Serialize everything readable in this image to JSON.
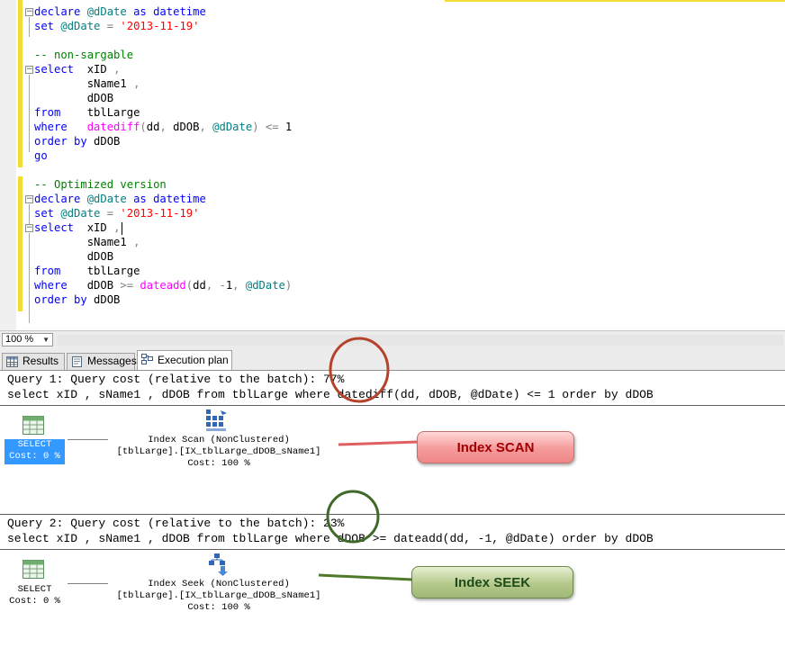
{
  "editor": {
    "lines": [
      [
        {
          "t": "declare ",
          "c": "kw"
        },
        {
          "t": "@dDate ",
          "c": "v"
        },
        {
          "t": "as ",
          "c": "kw"
        },
        {
          "t": "datetime",
          "c": "kw"
        }
      ],
      [
        {
          "t": "set ",
          "c": "kw"
        },
        {
          "t": "@dDate ",
          "c": "v"
        },
        {
          "t": "= ",
          "c": "op"
        },
        {
          "t": "'2013-11-19'",
          "c": "str"
        }
      ],
      [],
      [
        {
          "t": "-- non-sargable",
          "c": "cm"
        }
      ],
      [
        {
          "t": "select  ",
          "c": "kw"
        },
        {
          "t": "xID ",
          "c": ""
        },
        {
          "t": ",",
          "c": "op"
        }
      ],
      [
        {
          "t": "        sName1 ",
          "c": ""
        },
        {
          "t": ",",
          "c": "op"
        }
      ],
      [
        {
          "t": "        dDOB",
          "c": ""
        }
      ],
      [
        {
          "t": "from    ",
          "c": "kw"
        },
        {
          "t": "tblLarge",
          "c": ""
        }
      ],
      [
        {
          "t": "where   ",
          "c": "kw"
        },
        {
          "t": "datediff",
          "c": "fn"
        },
        {
          "t": "(",
          "c": "op"
        },
        {
          "t": "dd",
          "c": ""
        },
        {
          "t": ", ",
          "c": "op"
        },
        {
          "t": "dDOB",
          "c": ""
        },
        {
          "t": ", ",
          "c": "op"
        },
        {
          "t": "@dDate",
          "c": "v"
        },
        {
          "t": ") <= ",
          "c": "op"
        },
        {
          "t": "1",
          "c": ""
        }
      ],
      [
        {
          "t": "order by ",
          "c": "kw"
        },
        {
          "t": "dDOB",
          "c": ""
        }
      ],
      [
        {
          "t": "go",
          "c": "kw"
        }
      ],
      [],
      [
        {
          "t": "-- Optimized version",
          "c": "cm"
        }
      ],
      [
        {
          "t": "declare ",
          "c": "kw"
        },
        {
          "t": "@dDate ",
          "c": "v"
        },
        {
          "t": "as ",
          "c": "kw"
        },
        {
          "t": "datetime",
          "c": "kw"
        }
      ],
      [
        {
          "t": "set ",
          "c": "kw"
        },
        {
          "t": "@dDate ",
          "c": "v"
        },
        {
          "t": "= ",
          "c": "op"
        },
        {
          "t": "'2013-11-19'",
          "c": "str"
        }
      ],
      [
        {
          "t": "select  ",
          "c": "kw"
        },
        {
          "t": "xID ",
          "c": ""
        },
        {
          "t": ",",
          "c": "op"
        },
        {
          "t": "",
          "c": "caret"
        }
      ],
      [
        {
          "t": "        sName1 ",
          "c": ""
        },
        {
          "t": ",",
          "c": "op"
        }
      ],
      [
        {
          "t": "        dDOB",
          "c": ""
        }
      ],
      [
        {
          "t": "from    ",
          "c": "kw"
        },
        {
          "t": "tblLarge",
          "c": ""
        }
      ],
      [
        {
          "t": "where   ",
          "c": "kw"
        },
        {
          "t": "dDOB ",
          "c": ""
        },
        {
          "t": ">= ",
          "c": "op"
        },
        {
          "t": "dateadd",
          "c": "fn"
        },
        {
          "t": "(",
          "c": "op"
        },
        {
          "t": "dd",
          "c": ""
        },
        {
          "t": ", -",
          "c": "op"
        },
        {
          "t": "1",
          "c": ""
        },
        {
          "t": ", ",
          "c": "op"
        },
        {
          "t": "@dDate",
          "c": "v"
        },
        {
          "t": ")",
          "c": "op"
        }
      ],
      [
        {
          "t": "order by ",
          "c": "kw"
        },
        {
          "t": "dDOB",
          "c": ""
        }
      ]
    ]
  },
  "zoom": {
    "value": "100 %"
  },
  "tabs": {
    "results": "Results",
    "messages": "Messages",
    "plan": "Execution plan"
  },
  "plan": {
    "q1": {
      "header": "Query 1: Query cost (relative to the batch): 77%",
      "sql": "select xID , sName1 , dDOB from tblLarge where datediff(dd, dDOB, @dDate) <= 1 order by dDOB",
      "select_label": "SELECT\nCost: 0 %",
      "op_label": "Index Scan (NonClustered)\n[tblLarge].[IX_tblLarge_dDOB_sName1]\nCost: 100 %"
    },
    "q2": {
      "header": "Query 2: Query cost (relative to the batch): 23%",
      "sql": "select xID , sName1 , dDOB from tblLarge where dDOB >= dateadd(dd, -1, @dDate) order by dDOB",
      "select_label": "SELECT\nCost: 0 %",
      "op_label": "Index Seek (NonClustered)\n[tblLarge].[IX_tblLarge_dDOB_sName1]\nCost: 100 %"
    }
  },
  "callouts": {
    "scan": "Index SCAN",
    "seek": "Index SEEK"
  },
  "colors": {
    "keyword": "#0000ff",
    "function": "#ff00ff",
    "string": "#ff0000",
    "comment": "#008000",
    "variable": "#008080",
    "change_bar": "#f2dc35",
    "selection": "#3399ff",
    "scan_circle": "#b5422a",
    "seek_circle": "#3f6a2a"
  },
  "icons": {
    "results_tab": "grid-icon",
    "messages_tab": "document-icon",
    "plan_tab": "execution-plan-icon",
    "select_node": "table-icon",
    "scan_node": "index-scan-icon",
    "seek_node": "index-seek-icon"
  }
}
